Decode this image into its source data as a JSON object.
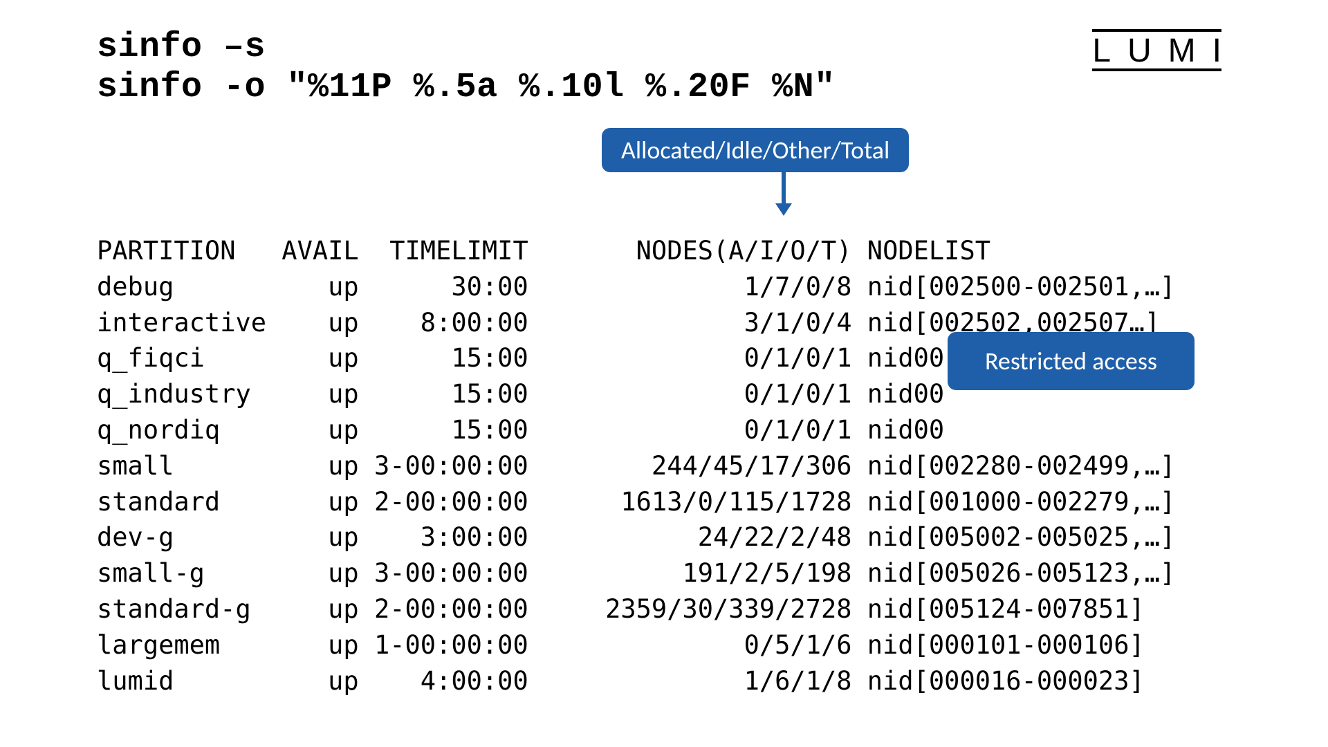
{
  "title_line1": "sinfo –s",
  "title_line2": "sinfo -o \"%11P %.5a %.10l %.20F %N\"",
  "logo_text": "LUMI",
  "callouts": {
    "aiot": "Allocated/Idle/Other/Total",
    "restricted": "Restricted access"
  },
  "columns": {
    "partition": "PARTITION",
    "avail": "AVAIL",
    "timelimit": "TIMELIMIT",
    "nodes": "NODES(A/I/O/T)",
    "nodelist": "NODELIST"
  },
  "rows": [
    {
      "partition": "debug",
      "avail": "up",
      "timelimit": "30:00",
      "nodes": "1/7/0/8",
      "nodelist": "nid[002500-002501,…]"
    },
    {
      "partition": "interactive",
      "avail": "up",
      "timelimit": "8:00:00",
      "nodes": "3/1/0/4",
      "nodelist": "nid[002502,002507…]"
    },
    {
      "partition": "q_fiqci",
      "avail": "up",
      "timelimit": "15:00",
      "nodes": "0/1/0/1",
      "nodelist": "nid00"
    },
    {
      "partition": "q_industry",
      "avail": "up",
      "timelimit": "15:00",
      "nodes": "0/1/0/1",
      "nodelist": "nid00"
    },
    {
      "partition": "q_nordiq",
      "avail": "up",
      "timelimit": "15:00",
      "nodes": "0/1/0/1",
      "nodelist": "nid00"
    },
    {
      "partition": "small",
      "avail": "up",
      "timelimit": "3-00:00:00",
      "nodes": "244/45/17/306",
      "nodelist": "nid[002280-002499,…]"
    },
    {
      "partition": "standard",
      "avail": "up",
      "timelimit": "2-00:00:00",
      "nodes": "1613/0/115/1728",
      "nodelist": "nid[001000-002279,…]"
    },
    {
      "partition": "dev-g",
      "avail": "up",
      "timelimit": "3:00:00",
      "nodes": "24/22/2/48",
      "nodelist": "nid[005002-005025,…]"
    },
    {
      "partition": "small-g",
      "avail": "up",
      "timelimit": "3-00:00:00",
      "nodes": "191/2/5/198",
      "nodelist": "nid[005026-005123,…]"
    },
    {
      "partition": "standard-g",
      "avail": "up",
      "timelimit": "2-00:00:00",
      "nodes": "2359/30/339/2728",
      "nodelist": "nid[005124-007851]"
    },
    {
      "partition": "largemem",
      "avail": "up",
      "timelimit": "1-00:00:00",
      "nodes": "0/5/1/6",
      "nodelist": "nid[000101-000106]"
    },
    {
      "partition": "lumid",
      "avail": "up",
      "timelimit": "4:00:00",
      "nodes": "1/6/1/8",
      "nodelist": "nid[000016-000023]"
    }
  ],
  "widths": {
    "partition": 11,
    "avail": 5,
    "timelimit": 10,
    "nodes": 20
  }
}
